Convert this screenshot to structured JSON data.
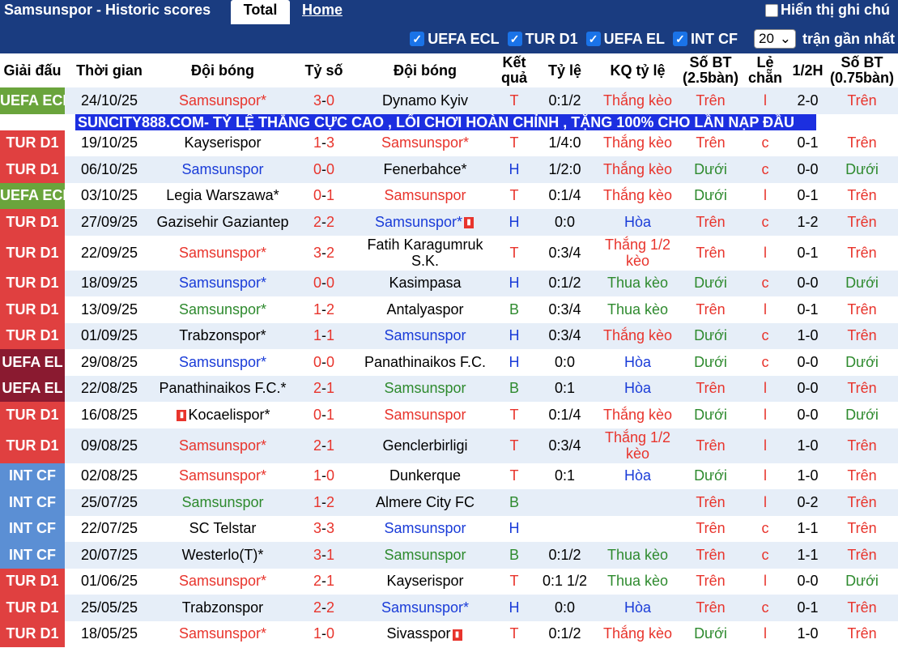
{
  "header": {
    "title": "Samsunspor - Historic scores",
    "tab_total": "Total",
    "tab_home": "Home",
    "show_notes": "Hiển thị ghi chú"
  },
  "filters": {
    "items": [
      "UEFA ECL",
      "TUR D1",
      "UEFA EL",
      "INT CF"
    ],
    "count_value": "20",
    "count_label": "trận gần nhất"
  },
  "columns": [
    "Giải đấu",
    "Thời gian",
    "Đội bóng",
    "Tỷ số",
    "Đội bóng",
    "Kết quả",
    "Tỷ lệ",
    "KQ tỷ lệ",
    "Số BT (2.5bàn)",
    "Lẻ chẵn",
    "1/2H",
    "Số BT (0.75bàn)"
  ],
  "banner": "SUNCITY888.COM- TỶ LỆ THẮNG CỰC CAO , LỐI CHƠI HOÀN CHỈNH , TẶNG 100% CHO LẦN NẠP ĐẦU",
  "colors": {
    "header_bg": "#1a3c80",
    "banner_bg": "#1c2fe0",
    "league_ecl": "#6aa43c",
    "league_tur": "#e04040",
    "league_el": "#8a1a30",
    "league_intcf": "#5b8fd4",
    "win_red": "#e8342c",
    "draw_blue": "#1a3cd8",
    "loss_green": "#2e8a2e"
  },
  "rows": [
    {
      "league": "UEFA ECL",
      "lclass": "ecl",
      "date": "24/10/25",
      "home": "Samsunspor*",
      "hc": "red",
      "hflag": false,
      "s1": "3",
      "s2": "0",
      "away": "Dynamo Kyiv",
      "ac": "blk",
      "aflag": false,
      "res": "T",
      "rc": "red",
      "odds": "0:1/2",
      "kq": "Thắng kèo",
      "kc": "red",
      "bt": "Trên",
      "btc": "red",
      "lc": "l",
      "half": "2-0",
      "bt2": "Trên",
      "bt2c": "red",
      "tall": false
    },
    {
      "league": "TUR D1",
      "lclass": "tur",
      "date": "19/10/25",
      "home": "Kayserispor",
      "hc": "blk",
      "hflag": false,
      "s1": "1",
      "s2": "3",
      "away": "Samsunspor*",
      "ac": "red",
      "aflag": false,
      "res": "T",
      "rc": "red",
      "odds": "1/4:0",
      "kq": "Thắng kèo",
      "kc": "red",
      "bt": "Trên",
      "btc": "red",
      "lc": "c",
      "half": "0-1",
      "bt2": "Trên",
      "bt2c": "red",
      "tall": false
    },
    {
      "league": "TUR D1",
      "lclass": "tur",
      "date": "06/10/25",
      "home": "Samsunspor",
      "hc": "blue",
      "hflag": false,
      "s1": "0",
      "s2": "0",
      "away": "Fenerbahce*",
      "ac": "blk",
      "aflag": false,
      "res": "H",
      "rc": "blue",
      "odds": "1/2:0",
      "kq": "Thắng kèo",
      "kc": "red",
      "bt": "Dưới",
      "btc": "green",
      "lc": "c",
      "half": "0-0",
      "bt2": "Dưới",
      "bt2c": "green",
      "tall": false
    },
    {
      "league": "UEFA ECL",
      "lclass": "ecl",
      "date": "03/10/25",
      "home": "Legia Warszawa*",
      "hc": "blk",
      "hflag": false,
      "s1": "0",
      "s2": "1",
      "away": "Samsunspor",
      "ac": "red",
      "aflag": false,
      "res": "T",
      "rc": "red",
      "odds": "0:1/4",
      "kq": "Thắng kèo",
      "kc": "red",
      "bt": "Dưới",
      "btc": "green",
      "lc": "l",
      "half": "0-1",
      "bt2": "Trên",
      "bt2c": "red",
      "tall": false
    },
    {
      "league": "TUR D1",
      "lclass": "tur",
      "date": "27/09/25",
      "home": "Gazisehir Gaziantep",
      "hc": "blk",
      "hflag": false,
      "s1": "2",
      "s2": "2",
      "away": "Samsunspor*",
      "ac": "blue",
      "aflag": true,
      "res": "H",
      "rc": "blue",
      "odds": "0:0",
      "kq": "Hòa",
      "kc": "blue",
      "bt": "Trên",
      "btc": "red",
      "lc": "c",
      "half": "1-2",
      "bt2": "Trên",
      "bt2c": "red",
      "tall": false
    },
    {
      "league": "TUR D1",
      "lclass": "tur",
      "date": "22/09/25",
      "home": "Samsunspor*",
      "hc": "red",
      "hflag": false,
      "s1": "3",
      "s2": "2",
      "away": "Fatih Karagumruk S.K.",
      "ac": "blk",
      "aflag": false,
      "res": "T",
      "rc": "red",
      "odds": "0:3/4",
      "kq": "Thắng 1/2 kèo",
      "kc": "red",
      "bt": "Trên",
      "btc": "red",
      "lc": "l",
      "half": "0-1",
      "bt2": "Trên",
      "bt2c": "red",
      "tall": true
    },
    {
      "league": "TUR D1",
      "lclass": "tur",
      "date": "18/09/25",
      "home": "Samsunspor*",
      "hc": "blue",
      "hflag": false,
      "s1": "0",
      "s2": "0",
      "away": "Kasimpasa",
      "ac": "blk",
      "aflag": false,
      "res": "H",
      "rc": "blue",
      "odds": "0:1/2",
      "kq": "Thua kèo",
      "kc": "green",
      "bt": "Dưới",
      "btc": "green",
      "lc": "c",
      "half": "0-0",
      "bt2": "Dưới",
      "bt2c": "green",
      "tall": false
    },
    {
      "league": "TUR D1",
      "lclass": "tur",
      "date": "13/09/25",
      "home": "Samsunspor*",
      "hc": "green",
      "hflag": false,
      "s1": "1",
      "s2": "2",
      "away": "Antalyaspor",
      "ac": "blk",
      "aflag": false,
      "res": "B",
      "rc": "green",
      "odds": "0:3/4",
      "kq": "Thua kèo",
      "kc": "green",
      "bt": "Trên",
      "btc": "red",
      "lc": "l",
      "half": "0-1",
      "bt2": "Trên",
      "bt2c": "red",
      "tall": false
    },
    {
      "league": "TUR D1",
      "lclass": "tur",
      "date": "01/09/25",
      "home": "Trabzonspor*",
      "hc": "blk",
      "hflag": false,
      "s1": "1",
      "s2": "1",
      "away": "Samsunspor",
      "ac": "blue",
      "aflag": false,
      "res": "H",
      "rc": "blue",
      "odds": "0:3/4",
      "kq": "Thắng kèo",
      "kc": "red",
      "bt": "Dưới",
      "btc": "green",
      "lc": "c",
      "half": "1-0",
      "bt2": "Trên",
      "bt2c": "red",
      "tall": false
    },
    {
      "league": "UEFA EL",
      "lclass": "el",
      "date": "29/08/25",
      "home": "Samsunspor*",
      "hc": "blue",
      "hflag": false,
      "s1": "0",
      "s2": "0",
      "away": "Panathinaikos F.C.",
      "ac": "blk",
      "aflag": false,
      "res": "H",
      "rc": "blue",
      "odds": "0:0",
      "kq": "Hòa",
      "kc": "blue",
      "bt": "Dưới",
      "btc": "green",
      "lc": "c",
      "half": "0-0",
      "bt2": "Dưới",
      "bt2c": "green",
      "tall": false
    },
    {
      "league": "UEFA EL",
      "lclass": "el",
      "date": "22/08/25",
      "home": "Panathinaikos F.C.*",
      "hc": "blk",
      "hflag": false,
      "s1": "2",
      "s2": "1",
      "away": "Samsunspor",
      "ac": "green",
      "aflag": false,
      "res": "B",
      "rc": "green",
      "odds": "0:1",
      "kq": "Hòa",
      "kc": "blue",
      "bt": "Trên",
      "btc": "red",
      "lc": "l",
      "half": "0-0",
      "bt2": "Trên",
      "bt2c": "red",
      "tall": false
    },
    {
      "league": "TUR D1",
      "lclass": "tur",
      "date": "16/08/25",
      "home": "Kocaelispor*",
      "hc": "blk",
      "hflag": true,
      "s1": "0",
      "s2": "1",
      "away": "Samsunspor",
      "ac": "red",
      "aflag": false,
      "res": "T",
      "rc": "red",
      "odds": "0:1/4",
      "kq": "Thắng kèo",
      "kc": "red",
      "bt": "Dưới",
      "btc": "green",
      "lc": "l",
      "half": "0-0",
      "bt2": "Dưới",
      "bt2c": "green",
      "tall": false
    },
    {
      "league": "TUR D1",
      "lclass": "tur",
      "date": "09/08/25",
      "home": "Samsunspor*",
      "hc": "red",
      "hflag": false,
      "s1": "2",
      "s2": "1",
      "away": "Genclerbirligi",
      "ac": "blk",
      "aflag": false,
      "res": "T",
      "rc": "red",
      "odds": "0:3/4",
      "kq": "Thắng 1/2 kèo",
      "kc": "red",
      "bt": "Trên",
      "btc": "red",
      "lc": "l",
      "half": "1-0",
      "bt2": "Trên",
      "bt2c": "red",
      "tall": true
    },
    {
      "league": "INT CF",
      "lclass": "intcf",
      "date": "02/08/25",
      "home": "Samsunspor*",
      "hc": "red",
      "hflag": false,
      "s1": "1",
      "s2": "0",
      "away": "Dunkerque",
      "ac": "blk",
      "aflag": false,
      "res": "T",
      "rc": "red",
      "odds": "0:1",
      "kq": "Hòa",
      "kc": "blue",
      "bt": "Dưới",
      "btc": "green",
      "lc": "l",
      "half": "1-0",
      "bt2": "Trên",
      "bt2c": "red",
      "tall": false
    },
    {
      "league": "INT CF",
      "lclass": "intcf",
      "date": "25/07/25",
      "home": "Samsunspor",
      "hc": "green",
      "hflag": false,
      "s1": "1",
      "s2": "2",
      "away": "Almere City FC",
      "ac": "blk",
      "aflag": false,
      "res": "B",
      "rc": "green",
      "odds": "",
      "kq": "",
      "kc": "blk",
      "bt": "Trên",
      "btc": "red",
      "lc": "l",
      "half": "0-2",
      "bt2": "Trên",
      "bt2c": "red",
      "tall": false
    },
    {
      "league": "INT CF",
      "lclass": "intcf",
      "date": "22/07/25",
      "home": "SC Telstar",
      "hc": "blk",
      "hflag": false,
      "s1": "3",
      "s2": "3",
      "away": "Samsunspor",
      "ac": "blue",
      "aflag": false,
      "res": "H",
      "rc": "blue",
      "odds": "",
      "kq": "",
      "kc": "blk",
      "bt": "Trên",
      "btc": "red",
      "lc": "c",
      "half": "1-1",
      "bt2": "Trên",
      "bt2c": "red",
      "tall": false
    },
    {
      "league": "INT CF",
      "lclass": "intcf",
      "date": "20/07/25",
      "home": "Westerlo(T)*",
      "hc": "blk",
      "hflag": false,
      "s1": "3",
      "s2": "1",
      "away": "Samsunspor",
      "ac": "green",
      "aflag": false,
      "res": "B",
      "rc": "green",
      "odds": "0:1/2",
      "kq": "Thua kèo",
      "kc": "green",
      "bt": "Trên",
      "btc": "red",
      "lc": "c",
      "half": "1-1",
      "bt2": "Trên",
      "bt2c": "red",
      "tall": false
    },
    {
      "league": "TUR D1",
      "lclass": "tur",
      "date": "01/06/25",
      "home": "Samsunspor*",
      "hc": "red",
      "hflag": false,
      "s1": "2",
      "s2": "1",
      "away": "Kayserispor",
      "ac": "blk",
      "aflag": false,
      "res": "T",
      "rc": "red",
      "odds": "0:1 1/2",
      "kq": "Thua kèo",
      "kc": "green",
      "bt": "Trên",
      "btc": "red",
      "lc": "l",
      "half": "0-0",
      "bt2": "Dưới",
      "bt2c": "green",
      "tall": false
    },
    {
      "league": "TUR D1",
      "lclass": "tur",
      "date": "25/05/25",
      "home": "Trabzonspor",
      "hc": "blk",
      "hflag": false,
      "s1": "2",
      "s2": "2",
      "away": "Samsunspor*",
      "ac": "blue",
      "aflag": false,
      "res": "H",
      "rc": "blue",
      "odds": "0:0",
      "kq": "Hòa",
      "kc": "blue",
      "bt": "Trên",
      "btc": "red",
      "lc": "c",
      "half": "0-1",
      "bt2": "Trên",
      "bt2c": "red",
      "tall": false
    },
    {
      "league": "TUR D1",
      "lclass": "tur",
      "date": "18/05/25",
      "home": "Samsunspor*",
      "hc": "red",
      "hflag": false,
      "s1": "1",
      "s2": "0",
      "away": "Sivasspor",
      "ac": "blk",
      "aflag": true,
      "res": "T",
      "rc": "red",
      "odds": "0:1/2",
      "kq": "Thắng kèo",
      "kc": "red",
      "bt": "Dưới",
      "btc": "green",
      "lc": "l",
      "half": "1-0",
      "bt2": "Trên",
      "bt2c": "red",
      "tall": false
    }
  ]
}
